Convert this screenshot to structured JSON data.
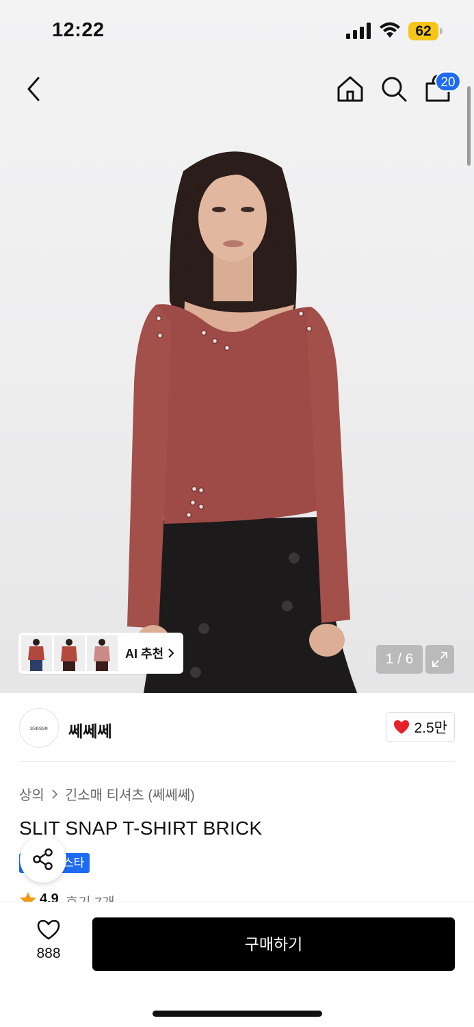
{
  "status_bar": {
    "time": "12:22",
    "battery": "62"
  },
  "header": {
    "cart_count": "20"
  },
  "gallery": {
    "ai_recommend_label": "AI 추천",
    "counter": "1 / 6",
    "thumbnail_colors": [
      "#b2473d",
      "#b44a3e",
      "#c98a88"
    ]
  },
  "brand": {
    "logo_text": "ssesse",
    "name": "쎄쎄쎄",
    "likes": "2.5만"
  },
  "breadcrumb": {
    "category": "상의",
    "subcategory": "긴소매 티셔츠 (쎄쎄쎄)"
  },
  "product": {
    "title": "SLIT SNAP T-SHIRT BRICK",
    "tag": "스타",
    "rating": "4.9",
    "reviews": "후기 7개"
  },
  "bottom_bar": {
    "wish_count": "888",
    "buy_label": "구매하기"
  },
  "colors": {
    "accent_blue": "#1d6bf2",
    "battery_yellow": "#f5c518",
    "heart_red": "#e8202a"
  }
}
